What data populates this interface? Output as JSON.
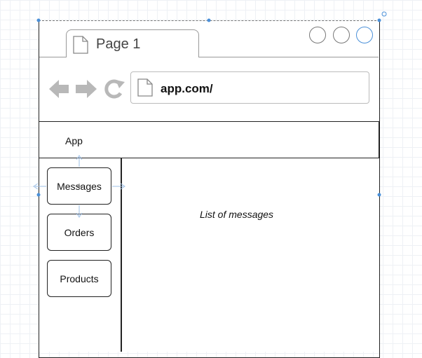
{
  "browser": {
    "tab": {
      "label": "Page 1",
      "icon": "page-icon"
    },
    "window_buttons": [
      "minimize",
      "maximize",
      "close"
    ],
    "nav": {
      "back_icon": "back-arrow-icon",
      "forward_icon": "forward-arrow-icon",
      "reload_icon": "reload-icon"
    },
    "address": {
      "icon": "page-icon",
      "url": "app.com/"
    }
  },
  "header": {
    "label": "App"
  },
  "sidebar": {
    "items": [
      {
        "label": "Messages"
      },
      {
        "label": "Orders"
      },
      {
        "label": "Products"
      }
    ]
  },
  "content": {
    "text": "List of messages"
  },
  "colors": {
    "selection": "#4a90d9",
    "stroke": "#222222",
    "grid": "#eef1f5"
  }
}
